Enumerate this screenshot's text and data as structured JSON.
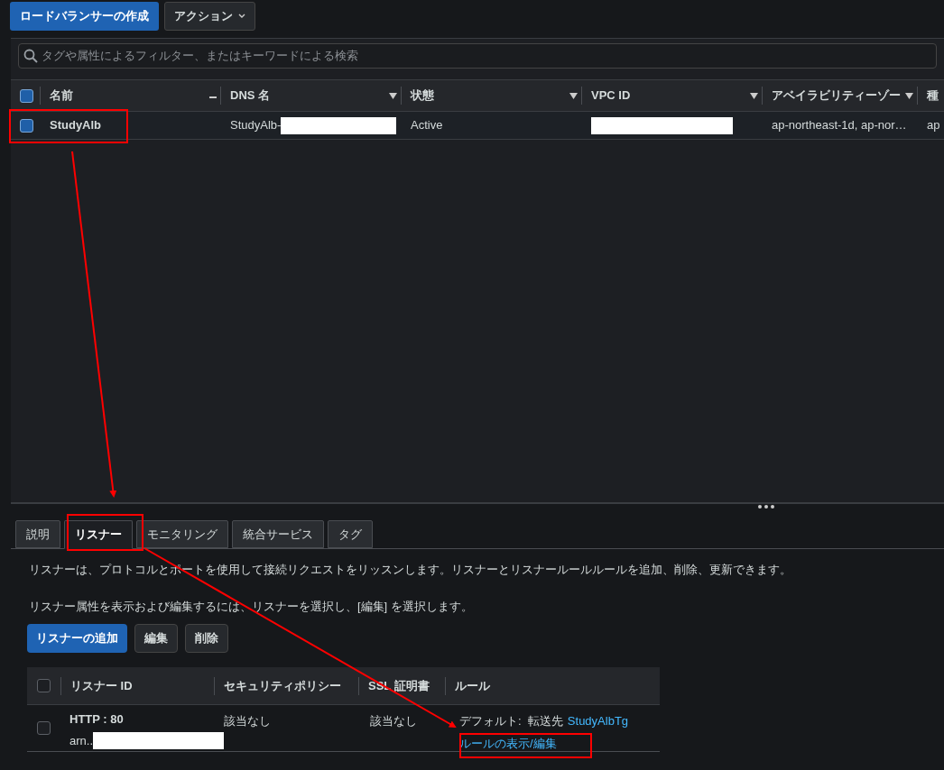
{
  "toolbar": {
    "buttons": [
      {
        "label": "ロードバランサーの作成",
        "kind": "primary"
      },
      {
        "label": "アクション",
        "kind": "dropdown"
      }
    ]
  },
  "search": {
    "placeholder": "タグや属性によるフィルター、またはキーワードによる検索"
  },
  "table": {
    "header_checked": true,
    "columns": [
      {
        "label": "名前",
        "kind": "sorted"
      },
      {
        "label": "DNS 名",
        "kind": "sortable"
      },
      {
        "label": "状態",
        "kind": "sortable"
      },
      {
        "label": "VPC ID",
        "kind": "sortable"
      },
      {
        "label": "アベイラビリティーゾー",
        "kind": "sortable"
      },
      {
        "label": "種",
        "kind": "plain"
      }
    ],
    "rows": [
      {
        "checked": true,
        "cells": [
          {
            "text": "StudyAlb",
            "redacted": false
          },
          {
            "text": "StudyAlb-",
            "redacted": true
          },
          {
            "text": "Active",
            "redacted": false
          },
          {
            "text": "",
            "redacted": true
          },
          {
            "text": "ap-northeast-1d, ap-nor…",
            "redacted": false
          },
          {
            "text": "ap",
            "redacted": false
          }
        ]
      }
    ]
  },
  "tabs": [
    {
      "label": "説明",
      "selected": false
    },
    {
      "label": "リスナー",
      "selected": true
    },
    {
      "label": "モニタリング",
      "selected": false
    },
    {
      "label": "統合サービス",
      "selected": false
    },
    {
      "label": "タグ",
      "selected": false
    }
  ],
  "description": [
    "リスナーは、プロトコルとポートを使用して接続リクエストをリッスンします。リスナーとリスナールールルールを追加、削除、更新できます。",
    "リスナー属性を表示および編集するには、リスナーを選択し、[編集] を選択します。"
  ],
  "listener_buttons": [
    {
      "label": "リスナーの追加",
      "kind": "primary"
    },
    {
      "label": "編集",
      "kind": "normal"
    },
    {
      "label": "削除",
      "kind": "normal"
    }
  ],
  "listeners": {
    "header_checked": false,
    "columns": [
      "リスナー ID",
      "セキュリティポリシー",
      "SSL 証明書",
      "ルール"
    ],
    "rows": [
      {
        "checked": false,
        "protocol": "HTTP : 80",
        "arn": "arn..",
        "security_policy": "該当なし",
        "certificate": "該当なし",
        "rule_prefix": "デフォルト:  転送先",
        "target_link": "StudyAlbTg",
        "rules_link": "ルールの表示/編集"
      }
    ]
  }
}
